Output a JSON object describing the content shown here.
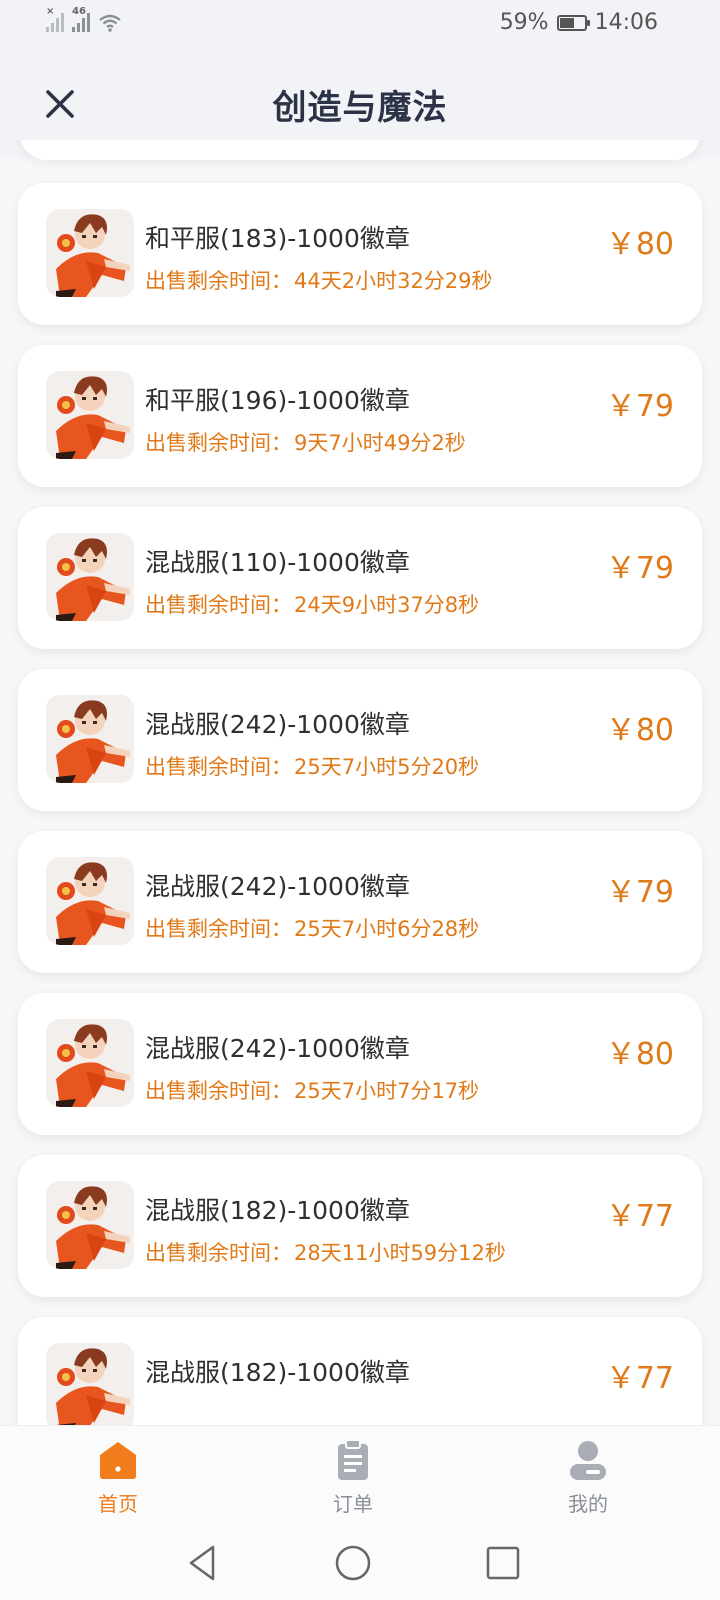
{
  "status_bar": {
    "net_label": "46",
    "battery_percent": "59%",
    "battery_level": 0.59,
    "time": "14:06"
  },
  "header": {
    "title": "创造与魔法",
    "close_icon": "close-icon"
  },
  "timer_prefix": "出售剩余时间：",
  "currency_symbol": "￥",
  "listings": [
    {
      "name": "和平服(183)-1000徽章",
      "time_left": "44天2小时32分29秒",
      "price": "80"
    },
    {
      "name": "和平服(196)-1000徽章",
      "time_left": "9天7小时49分2秒",
      "price": "79"
    },
    {
      "name": "混战服(110)-1000徽章",
      "time_left": "24天9小时37分8秒",
      "price": "79"
    },
    {
      "name": "混战服(242)-1000徽章",
      "time_left": "25天7小时5分20秒",
      "price": "80"
    },
    {
      "name": "混战服(242)-1000徽章",
      "time_left": "25天7小时6分28秒",
      "price": "79"
    },
    {
      "name": "混战服(242)-1000徽章",
      "time_left": "25天7小时7分17秒",
      "price": "80"
    },
    {
      "name": "混战服(182)-1000徽章",
      "time_left": "28天11小时59分12秒",
      "price": "77"
    },
    {
      "name": "混战服(182)-1000徽章",
      "time_left": "",
      "price": "77"
    }
  ],
  "tabbar": {
    "tabs": [
      {
        "label": "首页",
        "icon": "home-icon",
        "active": true
      },
      {
        "label": "订单",
        "icon": "clipboard-icon",
        "active": false
      },
      {
        "label": "我的",
        "icon": "user-icon",
        "active": false
      }
    ]
  },
  "colors": {
    "accent": "#e07a18",
    "title": "#2d3346",
    "background": "#f6f7f9"
  }
}
